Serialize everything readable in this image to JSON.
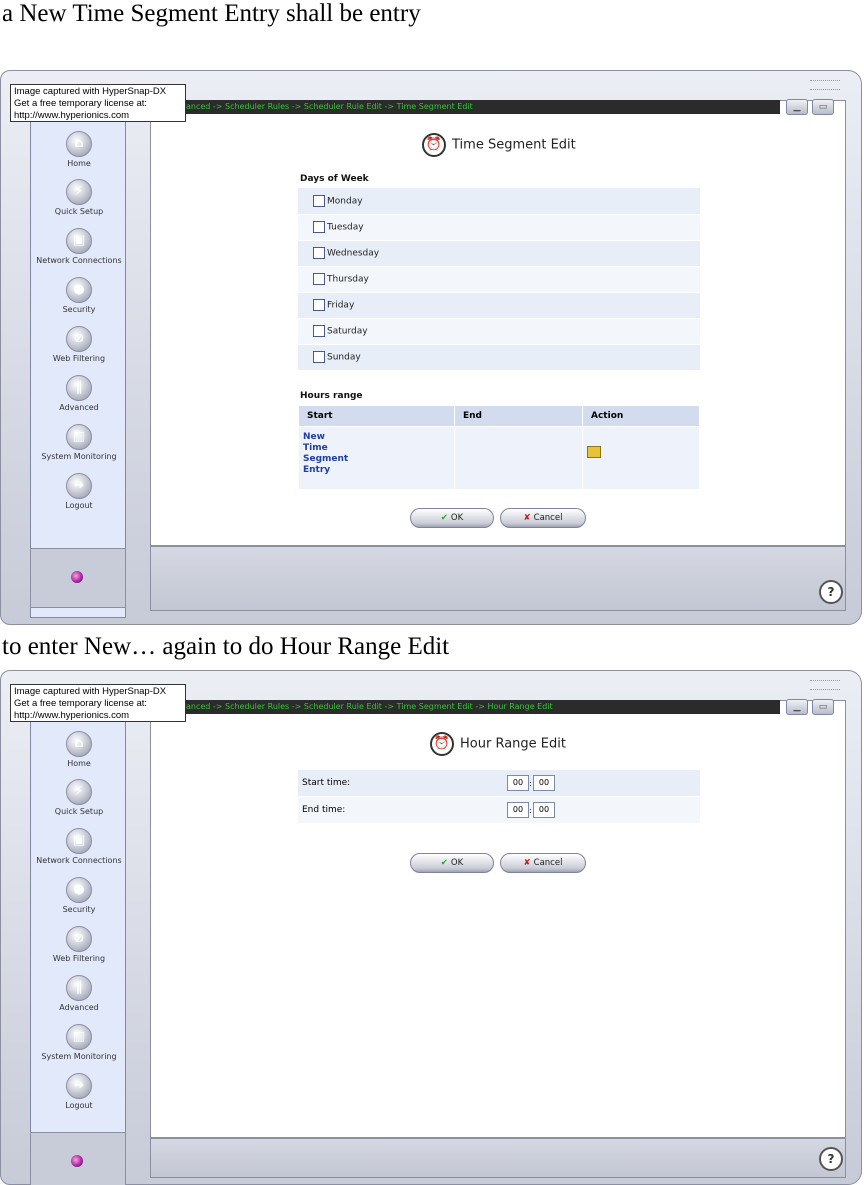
{
  "doc": {
    "caption_top": "a New Time Segment Entry shall be entry",
    "caption_middle": "to enter New… again to do Hour Range Edit"
  },
  "hypersnap": {
    "line1": "Image captured with HyperSnap-DX",
    "line2": "Get a free temporary license at:",
    "line3": "http://www.hyperionics.com"
  },
  "sidebar": {
    "items": [
      {
        "label": "Home",
        "icon": "home-icon"
      },
      {
        "label": "Quick Setup",
        "icon": "lightning-icon"
      },
      {
        "label": "Network Connections",
        "icon": "network-icon"
      },
      {
        "label": "Security",
        "icon": "lock-icon"
      },
      {
        "label": "Web Filtering",
        "icon": "filter-icon"
      },
      {
        "label": "Advanced",
        "icon": "advanced-icon"
      },
      {
        "label": "System Monitoring",
        "icon": "monitor-icon"
      },
      {
        "label": "Logout",
        "icon": "logout-icon"
      }
    ]
  },
  "screen1": {
    "breadcrumb": "anced -> Scheduler Rules -> Scheduler Rule Edit -> Time Segment Edit",
    "title": "Time Segment Edit",
    "days_heading": "Days of Week",
    "days": [
      "Monday",
      "Tuesday",
      "Wednesday",
      "Thursday",
      "Friday",
      "Saturday",
      "Sunday"
    ],
    "hours_heading": "Hours range",
    "columns": [
      "Start",
      "End",
      "Action"
    ],
    "new_entry": [
      "New",
      "Time",
      "Segment",
      "Entry"
    ],
    "ok": "OK",
    "cancel": "Cancel"
  },
  "screen2": {
    "breadcrumb": "anced -> Scheduler Rules -> Scheduler Rule Edit -> Time Segment Edit -> Hour Range Edit",
    "title": "Hour Range Edit",
    "start_label": "Start time:",
    "end_label": "End time:",
    "start_hour": "00",
    "start_min": "00",
    "end_hour": "00",
    "end_min": "00",
    "ok": "OK",
    "cancel": "Cancel"
  }
}
